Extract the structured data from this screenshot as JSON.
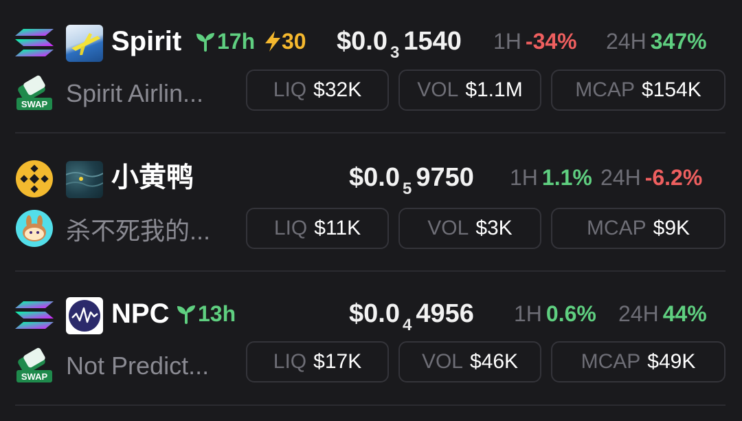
{
  "tokens": [
    {
      "chain_icon": "solana-icon",
      "dex_icon": "swap-icon",
      "dex_label": "SWAP",
      "symbol": "Spirit",
      "age": "17h",
      "boost": "30",
      "price_prefix": "$0.0",
      "price_zeros": "3",
      "price_digits": "1540",
      "h1_label": "1H",
      "h1_change": "-34%",
      "h24_label": "24H",
      "h24_change": "347%",
      "name": "Spirit Airlin...",
      "liq_label": "LIQ",
      "liq": "$32K",
      "vol_label": "VOL",
      "vol": "$1.1M",
      "mcap_label": "MCAP",
      "mcap": "$154K"
    },
    {
      "chain_icon": "bnb-icon",
      "dex_icon": "pancakeswap-icon",
      "symbol": "小黄鸭",
      "price_prefix": "$0.0",
      "price_zeros": "5",
      "price_digits": "9750",
      "h1_label": "1H",
      "h1_change": "1.1%",
      "h24_label": "24H",
      "h24_change": "-6.2%",
      "name": "杀不死我的...",
      "liq_label": "LIQ",
      "liq": "$11K",
      "vol_label": "VOL",
      "vol": "$3K",
      "mcap_label": "MCAP",
      "mcap": "$9K"
    },
    {
      "chain_icon": "solana-icon",
      "dex_icon": "swap-icon",
      "dex_label": "SWAP",
      "symbol": "NPC",
      "age": "13h",
      "price_prefix": "$0.0",
      "price_zeros": "4",
      "price_digits": "4956",
      "h1_label": "1H",
      "h1_change": "0.6%",
      "h24_label": "24H",
      "h24_change": "44%",
      "name": "Not Predict...",
      "liq_label": "LIQ",
      "liq": "$17K",
      "vol_label": "VOL",
      "vol": "$46K",
      "mcap_label": "MCAP",
      "mcap": "$49K"
    }
  ],
  "colors": {
    "background": "#1a1a1d",
    "positive": "#5fcf80",
    "negative": "#ef5f5f",
    "boost": "#f5b82e",
    "muted": "#6e6e76"
  }
}
